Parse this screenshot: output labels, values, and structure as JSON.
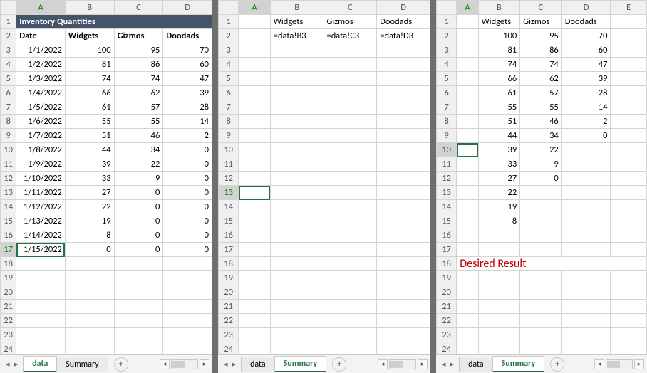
{
  "left": {
    "cols": [
      "",
      "A",
      "B",
      "C",
      "D"
    ],
    "titleRow": "Inventory Quantities",
    "headers": [
      "Date",
      "Widgets",
      "Gizmos",
      "Doodads"
    ],
    "rows": [
      [
        "1/1/2022",
        100,
        95,
        70
      ],
      [
        "1/2/2022",
        81,
        86,
        60
      ],
      [
        "1/3/2022",
        74,
        74,
        47
      ],
      [
        "1/4/2022",
        66,
        62,
        39
      ],
      [
        "1/5/2022",
        61,
        57,
        28
      ],
      [
        "1/6/2022",
        55,
        55,
        14
      ],
      [
        "1/7/2022",
        51,
        46,
        2
      ],
      [
        "1/8/2022",
        44,
        34,
        0
      ],
      [
        "1/9/2022",
        39,
        22,
        0
      ],
      [
        "1/10/2022",
        33,
        9,
        0
      ],
      [
        "1/11/2022",
        27,
        0,
        0
      ],
      [
        "1/12/2022",
        22,
        0,
        0
      ],
      [
        "1/13/2022",
        19,
        0,
        0
      ],
      [
        "1/14/2022",
        8,
        0,
        0
      ],
      [
        "1/15/2022",
        0,
        0,
        0
      ]
    ],
    "activeRow": 17,
    "activeCol": 1,
    "tabs": {
      "data": "data",
      "summary": "Summary",
      "active": "data"
    }
  },
  "mid": {
    "cols": [
      "",
      "A",
      "B",
      "C",
      "D"
    ],
    "headers": [
      "",
      "Widgets",
      "Gizmos",
      "Doodads"
    ],
    "formulaRow": [
      "",
      "=data!B3",
      "=data!C3",
      "=data!D3"
    ],
    "activeRow": 13,
    "activeCol": 1,
    "tabs": {
      "data": "data",
      "summary": "Summary",
      "active": "summary"
    }
  },
  "right": {
    "cols": [
      "",
      "A",
      "B",
      "C",
      "D",
      "E"
    ],
    "headers": [
      "",
      "Widgets",
      "Gizmos",
      "Doodads",
      ""
    ],
    "rows": [
      [
        "",
        100,
        95,
        70,
        ""
      ],
      [
        "",
        81,
        86,
        60,
        ""
      ],
      [
        "",
        74,
        74,
        47,
        ""
      ],
      [
        "",
        66,
        62,
        39,
        ""
      ],
      [
        "",
        61,
        57,
        28,
        ""
      ],
      [
        "",
        55,
        55,
        14,
        ""
      ],
      [
        "",
        51,
        46,
        2,
        ""
      ],
      [
        "",
        44,
        34,
        0,
        ""
      ],
      [
        "",
        39,
        22,
        "",
        ""
      ],
      [
        "",
        33,
        9,
        "",
        ""
      ],
      [
        "",
        27,
        0,
        "",
        ""
      ],
      [
        "",
        22,
        "",
        "",
        ""
      ],
      [
        "",
        19,
        "",
        "",
        ""
      ],
      [
        "",
        8,
        "",
        "",
        ""
      ]
    ],
    "activeRow": 10,
    "activeCol": 1,
    "annotation": "Desired Result",
    "tabs": {
      "data": "data",
      "summary": "Summary",
      "active": "summary"
    }
  },
  "chart_data": {
    "type": "table",
    "title": "Inventory Quantities",
    "columns": [
      "Date",
      "Widgets",
      "Gizmos",
      "Doodads"
    ],
    "data": [
      [
        "1/1/2022",
        100,
        95,
        70
      ],
      [
        "1/2/2022",
        81,
        86,
        60
      ],
      [
        "1/3/2022",
        74,
        74,
        47
      ],
      [
        "1/4/2022",
        66,
        62,
        39
      ],
      [
        "1/5/2022",
        61,
        57,
        28
      ],
      [
        "1/6/2022",
        55,
        55,
        14
      ],
      [
        "1/7/2022",
        51,
        46,
        2
      ],
      [
        "1/8/2022",
        44,
        34,
        0
      ],
      [
        "1/9/2022",
        39,
        22,
        0
      ],
      [
        "1/10/2022",
        33,
        9,
        0
      ],
      [
        "1/11/2022",
        27,
        0,
        0
      ],
      [
        "1/12/2022",
        22,
        0,
        0
      ],
      [
        "1/13/2022",
        19,
        0,
        0
      ],
      [
        "1/14/2022",
        8,
        0,
        0
      ],
      [
        "1/15/2022",
        0,
        0,
        0
      ]
    ]
  },
  "icons": {
    "navLeft": "◂",
    "navRight": "▸",
    "plus": "+",
    "scrollL": "◂",
    "scrollR": "▸"
  }
}
